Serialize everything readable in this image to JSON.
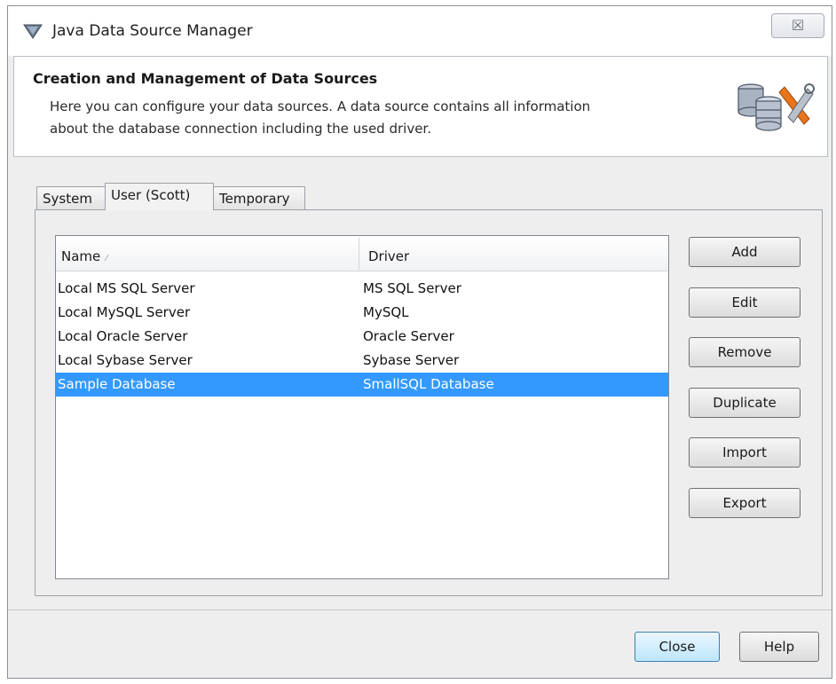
{
  "window": {
    "title": "Java Data Source Manager",
    "close_glyph": "☒"
  },
  "banner": {
    "title": "Creation and Management of Data Sources",
    "description_line1": "Here you can configure your data sources. A data source contains all information",
    "description_line2": "about the database connection including the used driver.",
    "icon": "database-tools-icon"
  },
  "tabs": [
    {
      "label": "System",
      "active": false
    },
    {
      "label": "User (Scott)",
      "active": true
    },
    {
      "label": "Temporary",
      "active": false
    }
  ],
  "table": {
    "columns": [
      "Name",
      "Driver"
    ],
    "sort_glyph": "⁄",
    "rows": [
      {
        "name": "Local MS SQL Server",
        "driver": "MS SQL Server",
        "selected": false
      },
      {
        "name": "Local MySQL Server",
        "driver": "MySQL",
        "selected": false
      },
      {
        "name": "Local Oracle Server",
        "driver": "Oracle Server",
        "selected": false
      },
      {
        "name": "Local Sybase Server",
        "driver": "Sybase Server",
        "selected": false
      },
      {
        "name": "Sample Database",
        "driver": "SmallSQL Database",
        "selected": true
      }
    ]
  },
  "buttons": {
    "add": "Add",
    "edit": "Edit",
    "remove": "Remove",
    "duplicate": "Duplicate",
    "import": "Import",
    "export": "Export"
  },
  "footer": {
    "close": "Close",
    "help": "Help"
  },
  "colors": {
    "selection": "#3399ff",
    "icon_orange": "#e8751a"
  }
}
